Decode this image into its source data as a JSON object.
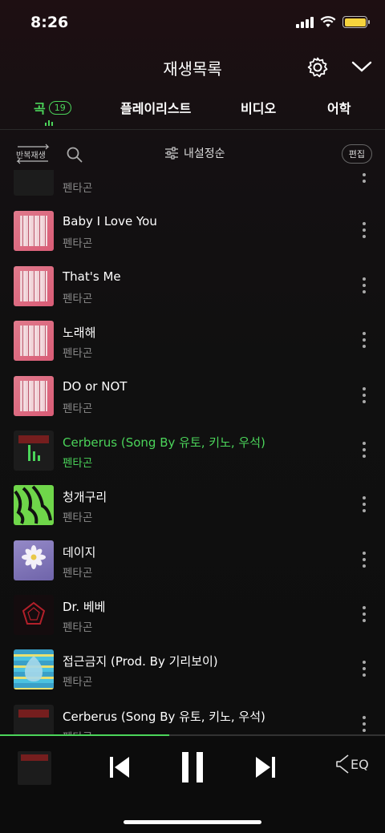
{
  "status": {
    "time": "8:26"
  },
  "header": {
    "title": "재생목록",
    "settings_icon": "gear-icon",
    "collapse_icon": "chevron-down-icon"
  },
  "tabs": [
    {
      "label": "곡",
      "count": "19",
      "active": true
    },
    {
      "label": "플레이리스트"
    },
    {
      "label": "비디오"
    },
    {
      "label": "어학"
    }
  ],
  "toolbar": {
    "repeat_label": "반복재생",
    "sort_label": "내설정순",
    "edit_label": "편집"
  },
  "tracks": [
    {
      "title": "",
      "artist": "펜타곤",
      "art": "dark-cover"
    },
    {
      "title": "Baby I Love You",
      "artist": "펜타곤",
      "art": "pink-cover"
    },
    {
      "title": "That's Me",
      "artist": "펜타곤",
      "art": "pink-cover"
    },
    {
      "title": "노래해",
      "artist": "펜타곤",
      "art": "pink-cover"
    },
    {
      "title": "DO or NOT",
      "artist": "펜타곤",
      "art": "pink-cover"
    },
    {
      "title": "Cerberus (Song By 유토, 키노, 우석)",
      "artist": "펜타곤",
      "art": "dark-cover",
      "playing": true
    },
    {
      "title": "청개구리",
      "artist": "펜타곤",
      "art": "green-cover"
    },
    {
      "title": "데이지",
      "artist": "펜타곤",
      "art": "purple-cover"
    },
    {
      "title": "Dr. 베베",
      "artist": "펜타곤",
      "art": "red-cover"
    },
    {
      "title": "접근금지 (Prod. By 기리보이)",
      "artist": "펜타곤",
      "art": "wave-cover"
    },
    {
      "title": "Cerberus (Song By 유토, 키노, 우석)",
      "artist": "펜타곤",
      "art": "dark-cover"
    }
  ],
  "player": {
    "progress": 0.44,
    "eq_label": "EQ"
  },
  "colors": {
    "accent": "#4bd45a",
    "background": "#101010",
    "muted_text": "#8a8a8a"
  }
}
